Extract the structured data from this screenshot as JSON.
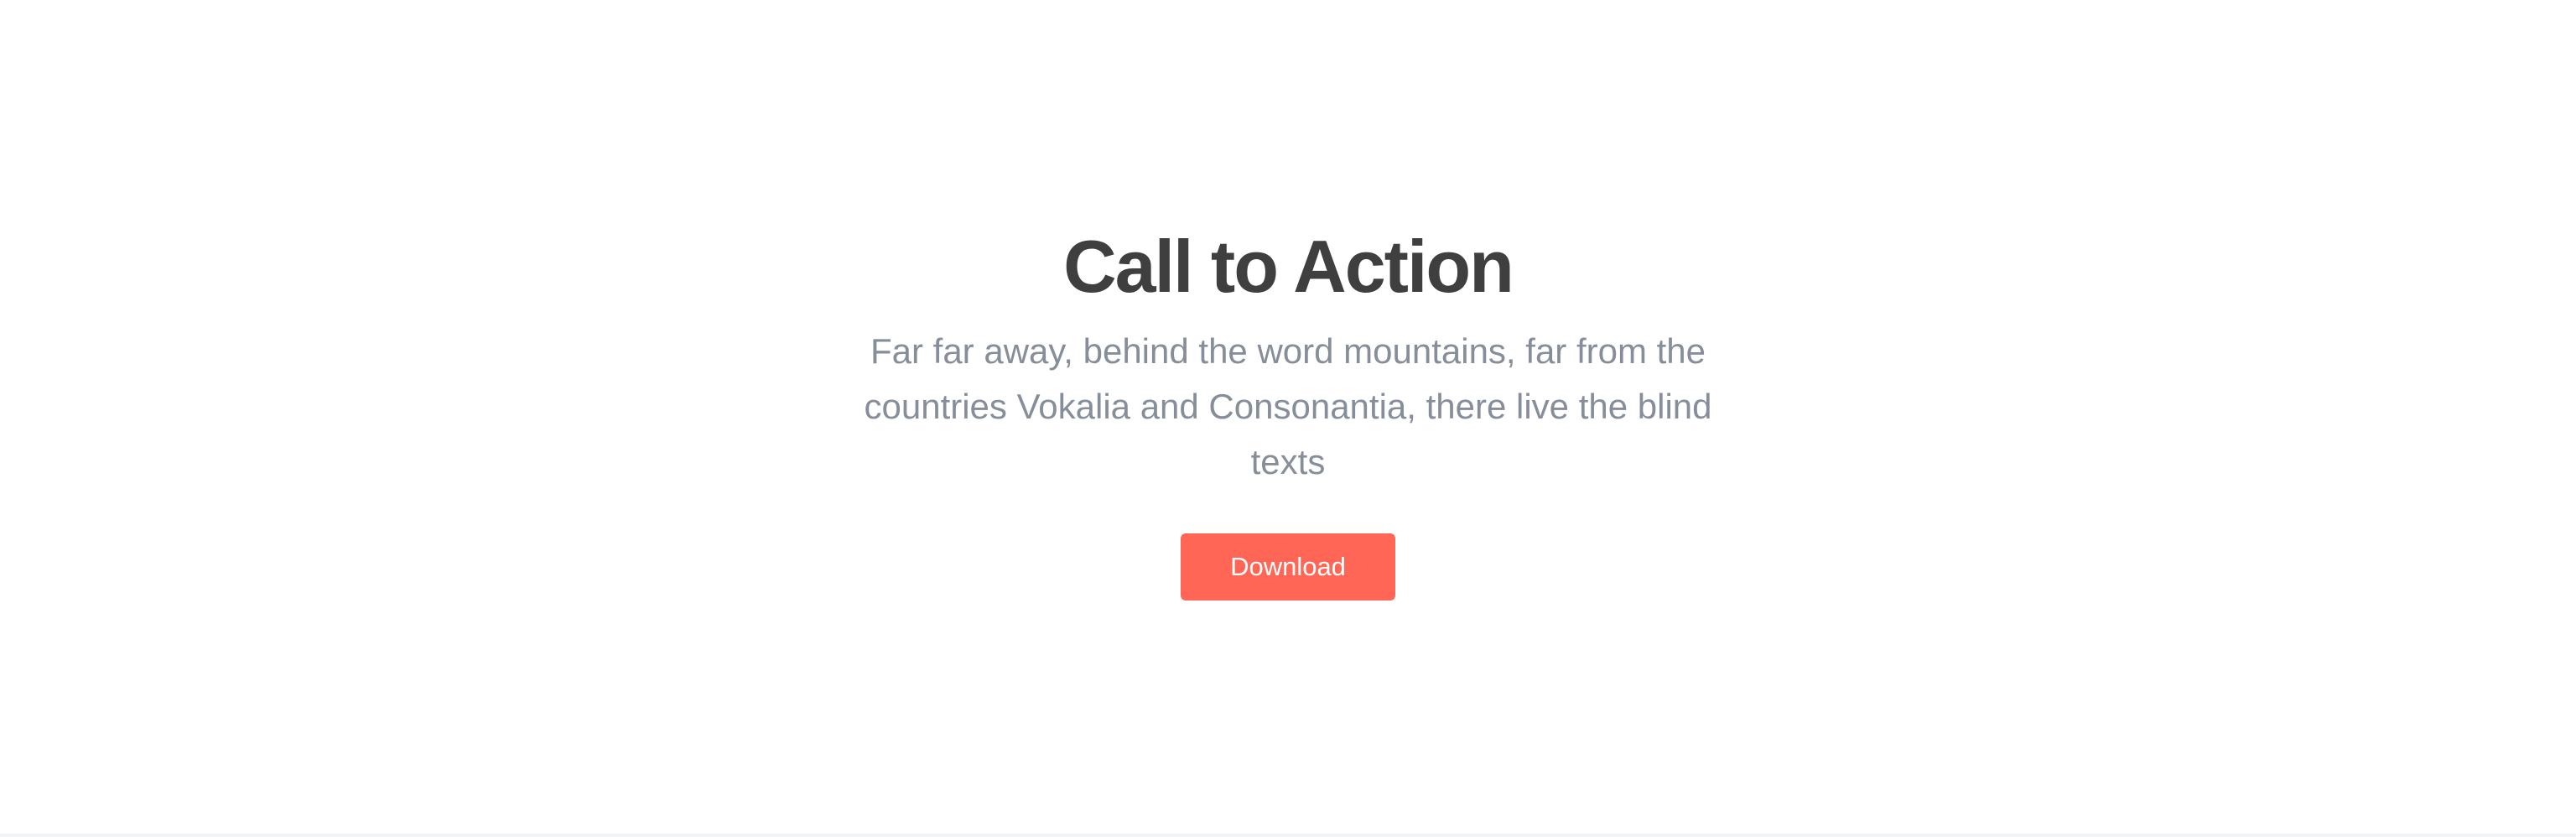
{
  "cta": {
    "title": "Call to Action",
    "text": "Far far away, behind the word mountains, far from the countries Vokalia and Consonantia, there live the blind texts",
    "button_label": "Download"
  },
  "colors": {
    "title": "#3f3f40",
    "text": "#868e99",
    "button_background": "#ff6655",
    "button_text": "#ffffff",
    "page_background": "#ffffff"
  }
}
